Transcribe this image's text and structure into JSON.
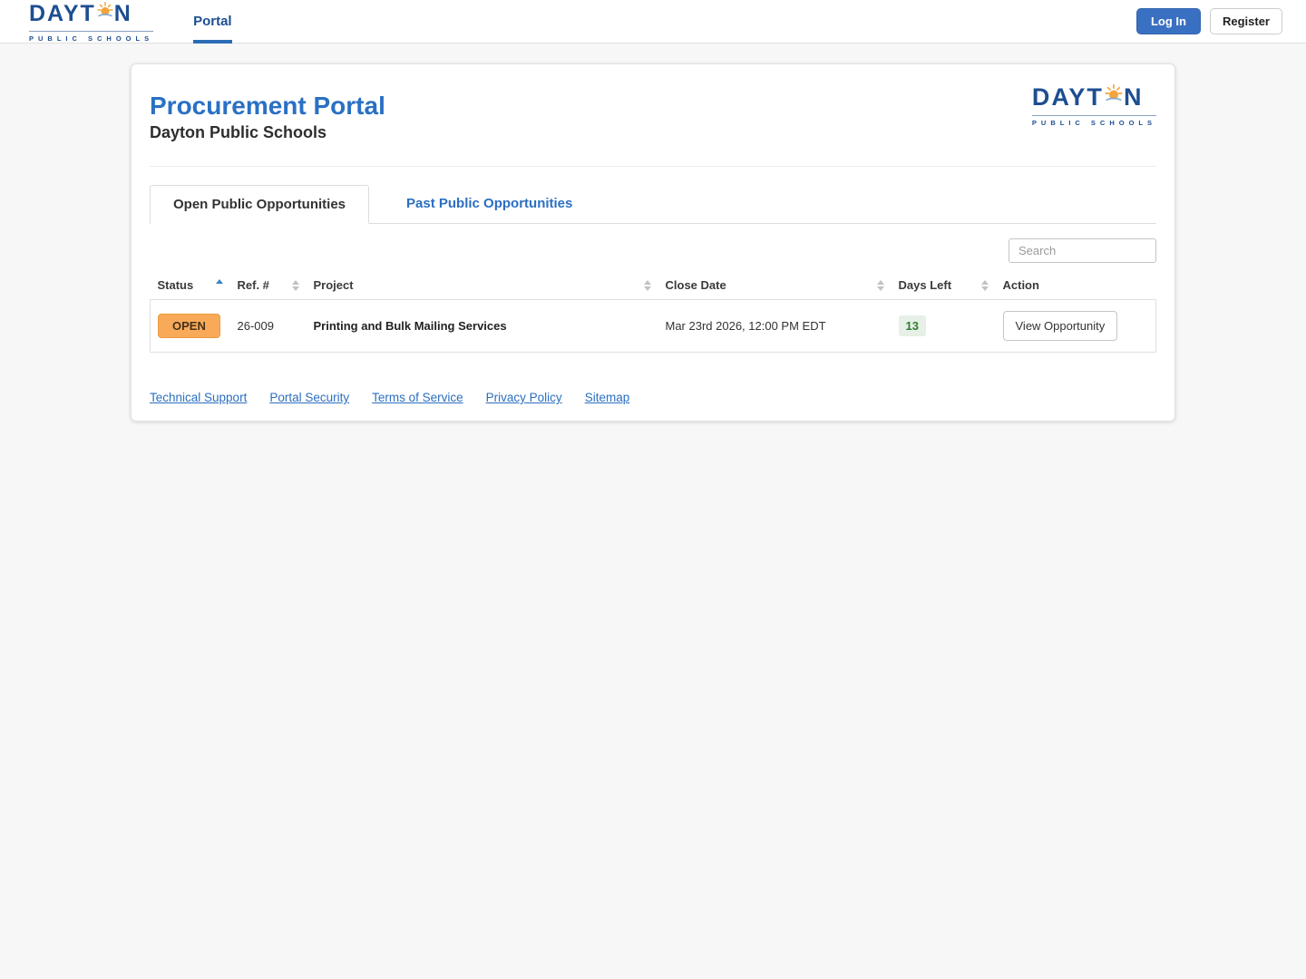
{
  "colors": {
    "accent_blue": "#2b6fc0",
    "logo_navy": "#1d4e91",
    "title_blue": "#2a70c4",
    "login_button_bg": "#3a70c2",
    "open_badge_bg": "#f9aa58",
    "days_left_green": "#2e7d32",
    "page_background": "#f7f7f7"
  },
  "logo": {
    "word_start": "DAYT",
    "word_end": "N",
    "subtitle": "PUBLIC SCHOOLS"
  },
  "top_nav": {
    "portal_label": "Portal",
    "login_label": "Log In",
    "register_label": "Register"
  },
  "portal_card": {
    "title": "Procurement Portal",
    "subtitle": "Dayton Public Schools",
    "tabs": [
      {
        "label": "Open Public Opportunities",
        "active": true
      },
      {
        "label": "Past Public Opportunities",
        "active": false
      }
    ],
    "search": {
      "placeholder": "Search"
    },
    "table": {
      "columns": [
        {
          "label": "Status",
          "sort": "asc"
        },
        {
          "label": "Ref. #",
          "sort": "both"
        },
        {
          "label": "Project",
          "sort": "both"
        },
        {
          "label": "Close Date",
          "sort": "both"
        },
        {
          "label": "Days Left",
          "sort": "both"
        },
        {
          "label": "Action",
          "sort": "none"
        }
      ],
      "rows": [
        {
          "status": "OPEN",
          "ref": "26-009",
          "project": "Printing and Bulk Mailing Services",
          "close_date": "Mar 23rd 2026, 12:00 PM EDT",
          "days_left": "13",
          "action_label": "View Opportunity"
        }
      ]
    },
    "footer_links": [
      "Technical Support",
      "Portal Security",
      "Terms of Service",
      "Privacy Policy",
      "Sitemap"
    ]
  }
}
